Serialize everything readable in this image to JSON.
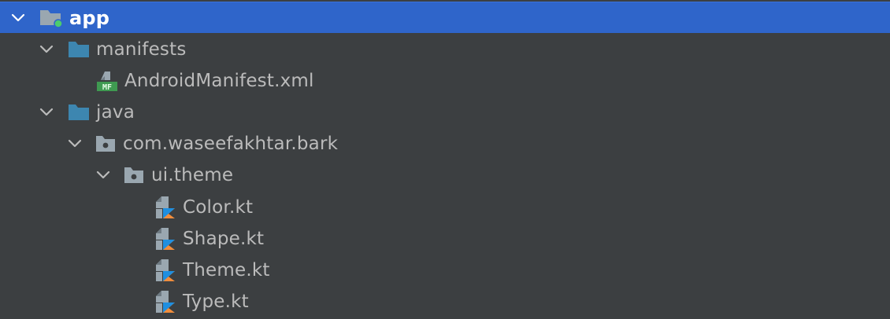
{
  "project_tree": {
    "app": {
      "label": "app",
      "icon": "module-folder-icon",
      "expanded": true,
      "selected": true
    },
    "manifests": {
      "label": "manifests",
      "icon": "folder-icon",
      "expanded": true
    },
    "android_manifest": {
      "label": "AndroidManifest.xml",
      "icon": "manifest-file-icon",
      "badge": "MF"
    },
    "java": {
      "label": "java",
      "icon": "folder-icon",
      "expanded": true
    },
    "package_root": {
      "label": "com.waseefakhtar.bark",
      "icon": "package-icon",
      "expanded": true
    },
    "package_theme": {
      "label": "ui.theme",
      "icon": "package-icon",
      "expanded": true
    },
    "files": [
      {
        "label": "Color.kt",
        "icon": "kotlin-file-icon"
      },
      {
        "label": "Shape.kt",
        "icon": "kotlin-file-icon"
      },
      {
        "label": "Theme.kt",
        "icon": "kotlin-file-icon"
      },
      {
        "label": "Type.kt",
        "icon": "kotlin-file-icon"
      }
    ]
  },
  "colors": {
    "background": "#3c3f41",
    "selection": "#2f65ca",
    "text": "#bbbbbb",
    "folder": "#3d86b0",
    "manifest_badge": "#3f9a51",
    "kotlin_orange": "#f18d3c",
    "kotlin_blue": "#1f8fe0",
    "module_dot": "#4ccd6d"
  }
}
